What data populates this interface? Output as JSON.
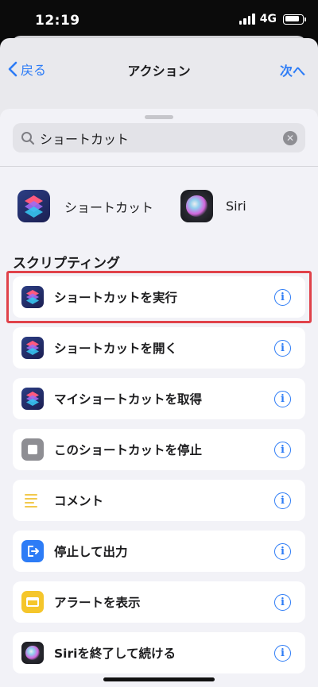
{
  "status": {
    "time": "12:19",
    "network": "4G",
    "battery_level": 0.85
  },
  "nav": {
    "back_label": "戻る",
    "title": "アクション",
    "next_label": "次へ"
  },
  "search": {
    "value": "ショートカット"
  },
  "apps": [
    {
      "label": "ショートカット",
      "icon": "shortcuts-app-icon"
    },
    {
      "label": "Siri",
      "icon": "siri-app-icon"
    }
  ],
  "section": {
    "title": "スクリプティング"
  },
  "actions": [
    {
      "label": "ショートカットを実行",
      "icon": "shortcuts-icon",
      "highlighted": true
    },
    {
      "label": "ショートカットを開く",
      "icon": "shortcuts-icon"
    },
    {
      "label": "マイショートカットを取得",
      "icon": "shortcuts-icon"
    },
    {
      "label": "このショートカットを停止",
      "icon": "stop-icon"
    },
    {
      "label": "コメント",
      "icon": "comment-icon"
    },
    {
      "label": "停止して出力",
      "icon": "exit-icon"
    },
    {
      "label": "アラートを表示",
      "icon": "alert-icon"
    },
    {
      "label": "Siriを終了して続ける",
      "icon": "siri-icon"
    }
  ],
  "colors": {
    "accent": "#2d7cf6",
    "highlight": "#e0424a",
    "background": "#f2f2f7"
  }
}
